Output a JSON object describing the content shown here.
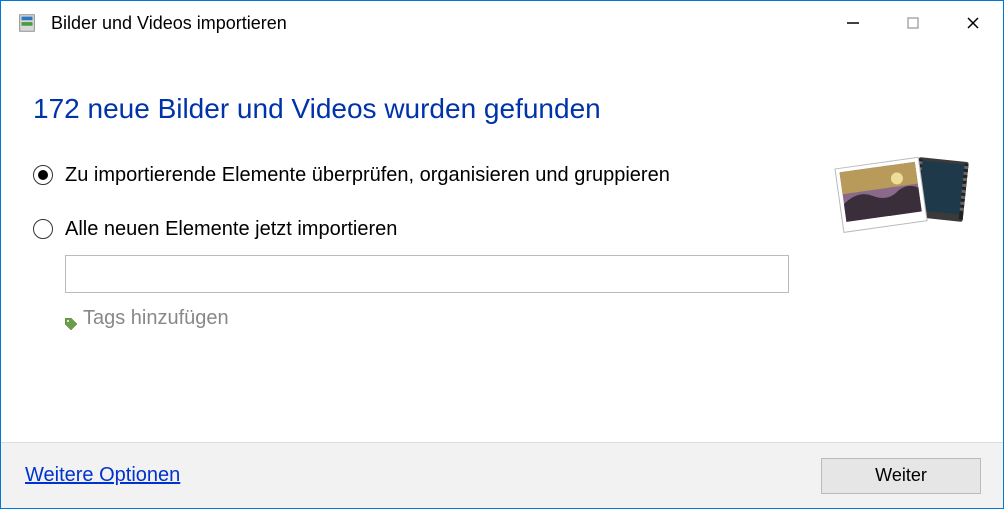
{
  "titlebar": {
    "title": "Bilder und Videos importieren"
  },
  "headline": "172 neue Bilder und Videos wurden gefunden",
  "options": {
    "review": {
      "label": "Zu importierende Elemente überprüfen, organisieren und gruppieren",
      "selected": true
    },
    "import_all": {
      "label": "Alle neuen Elemente jetzt importieren",
      "selected": false
    },
    "tag_input_value": "",
    "tag_hint": "Tags hinzufügen"
  },
  "footer": {
    "more_options": "Weitere Optionen",
    "next": "Weiter"
  }
}
